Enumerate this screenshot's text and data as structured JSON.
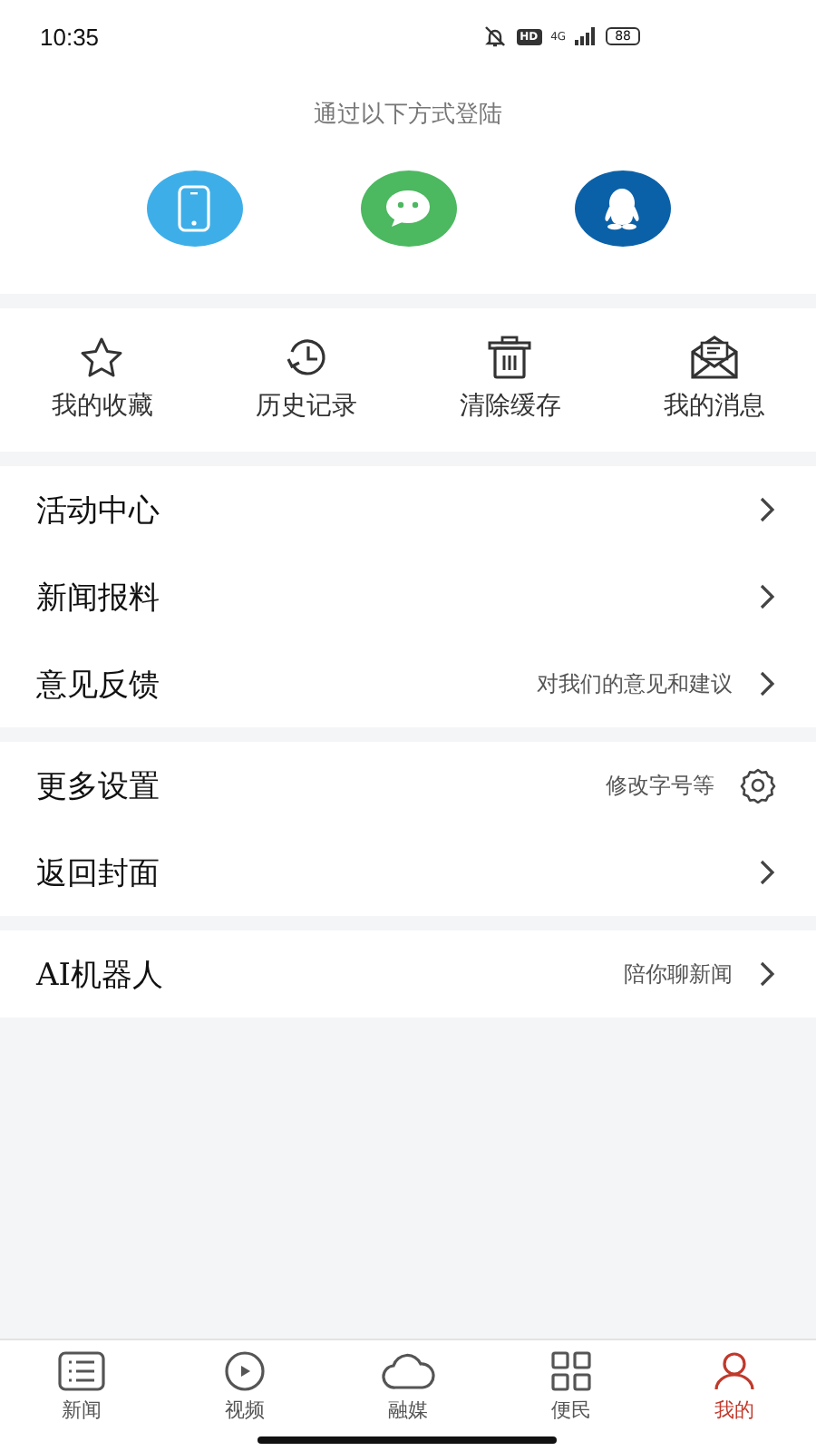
{
  "status_bar": {
    "time": "10:35",
    "hd": "HD",
    "network": "4G",
    "battery": "88"
  },
  "login": {
    "title": "通过以下方式登陆",
    "methods": [
      {
        "kind": "phone",
        "color": "#3eaee8"
      },
      {
        "kind": "wechat",
        "color": "#4cb860"
      },
      {
        "kind": "qq",
        "color": "#0b61a8"
      }
    ]
  },
  "quick_actions": [
    {
      "kind": "star",
      "label": "我的收藏"
    },
    {
      "kind": "history",
      "label": "历史记录"
    },
    {
      "kind": "trash",
      "label": "清除缓存"
    },
    {
      "kind": "mail",
      "label": "我的消息"
    }
  ],
  "menu_groups": [
    [
      {
        "label": "活动中心",
        "kind": "chevron"
      },
      {
        "label": "新闻报料",
        "kind": "chevron"
      },
      {
        "label": "意见反馈",
        "hint": "对我们的意见和建议",
        "kind": "chevron"
      }
    ],
    [
      {
        "label": "更多设置",
        "hint": "修改字号等",
        "kind": "gear"
      },
      {
        "label": "返回封面",
        "kind": "chevron"
      }
    ],
    [
      {
        "label": "AI机器人",
        "hint": "陪你聊新闻",
        "kind": "chevron"
      }
    ]
  ],
  "tab_bar": [
    {
      "kind": "list",
      "label": "新闻",
      "selected": false
    },
    {
      "kind": "play",
      "label": "视频",
      "selected": false
    },
    {
      "kind": "cloud",
      "label": "融媒",
      "selected": false
    },
    {
      "kind": "grid",
      "label": "便民",
      "selected": false
    },
    {
      "kind": "user",
      "label": "我的",
      "selected": true
    }
  ]
}
